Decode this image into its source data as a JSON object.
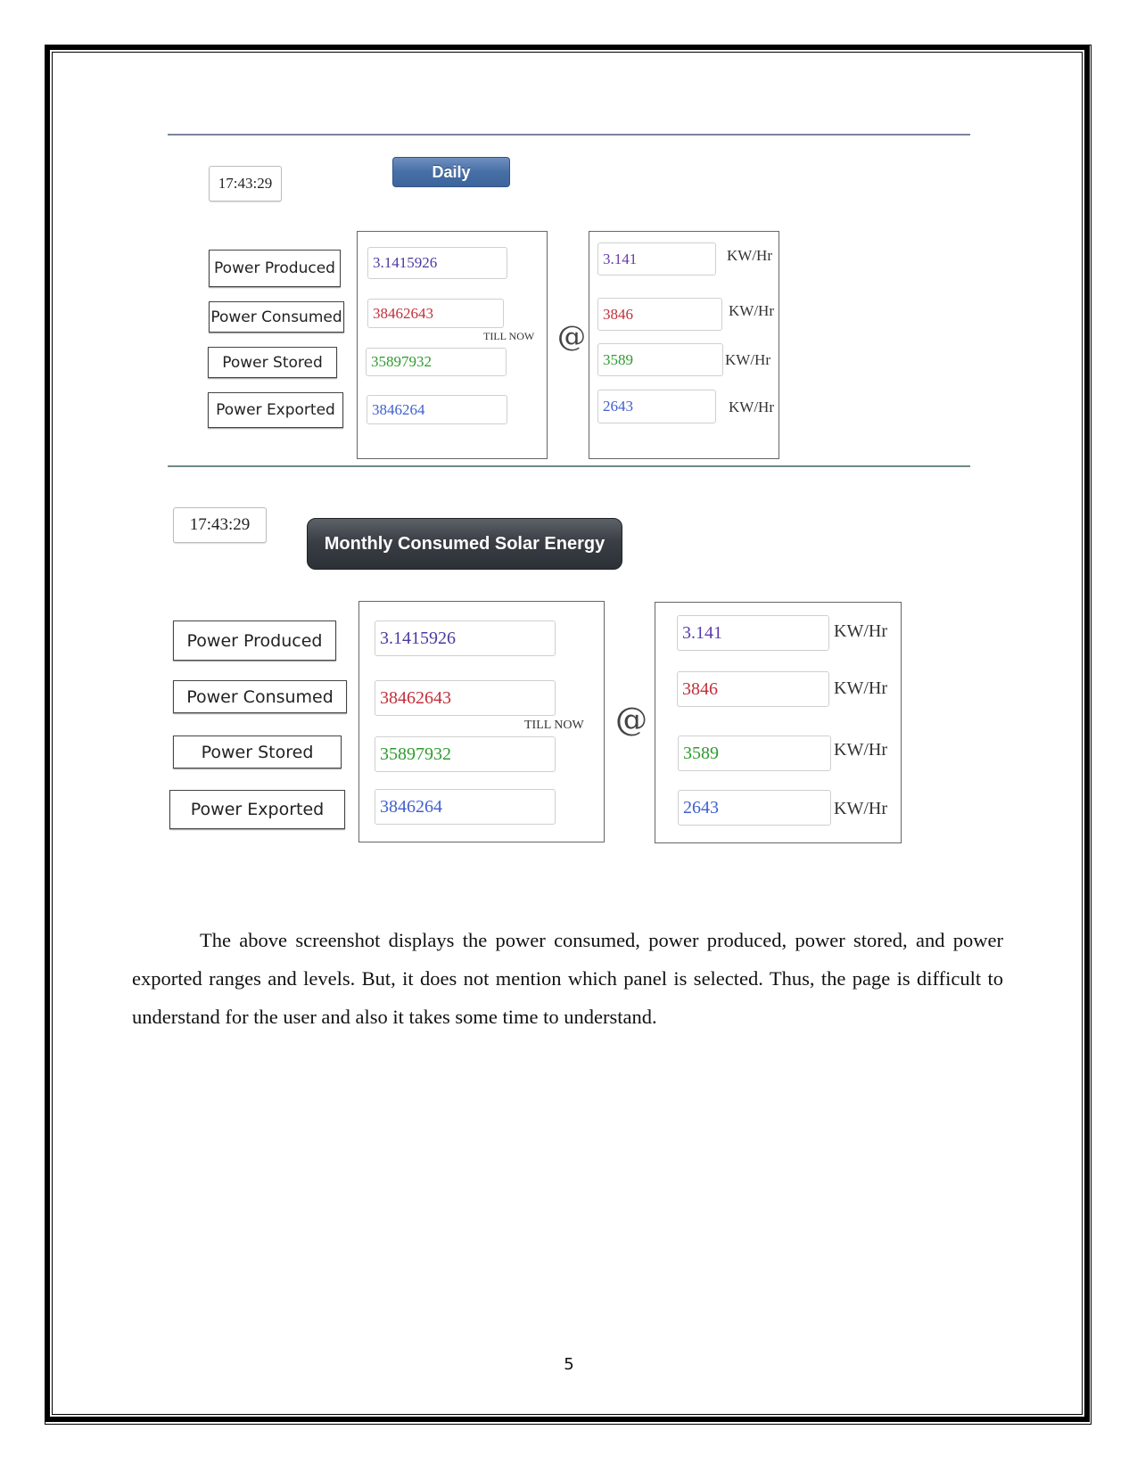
{
  "colors": {
    "produced": "#4b3aa0",
    "consumed": "#c0303a",
    "stored": "#2e9a2e",
    "exported": "#3f5fcf"
  },
  "daily_panel": {
    "time": "17:43:29",
    "mode_button": "Daily",
    "labels": [
      "Power Produced",
      "Power Consumed",
      "Power Stored",
      "Power Exported"
    ],
    "totals": [
      "3.1415926",
      "38462643",
      "35897932",
      "3846264"
    ],
    "till_now": "TILL NOW",
    "at_symbol": "@",
    "rates": [
      "3.141",
      "3846",
      "3589",
      "2643"
    ],
    "unit": "KW/Hr"
  },
  "monthly_panel": {
    "time": "17:43:29",
    "mode_button": "Monthly Consumed Solar Energy",
    "labels": [
      "Power Produced",
      "Power Consumed",
      "Power Stored",
      "Power Exported"
    ],
    "totals": [
      "3.1415926",
      "38462643",
      "35897932",
      "3846264"
    ],
    "till_now": "TILL NOW",
    "at_symbol": "@",
    "rates": [
      "3.141",
      "3846",
      "3589",
      "2643"
    ],
    "unit": "KW/Hr"
  },
  "body_text": "The above screenshot displays the power consumed, power produced, power stored, and power exported ranges and levels. But, it does not mention which panel is selected. Thus, the page is difficult to understand for the user and also it takes some time to understand.",
  "page_number": "5"
}
